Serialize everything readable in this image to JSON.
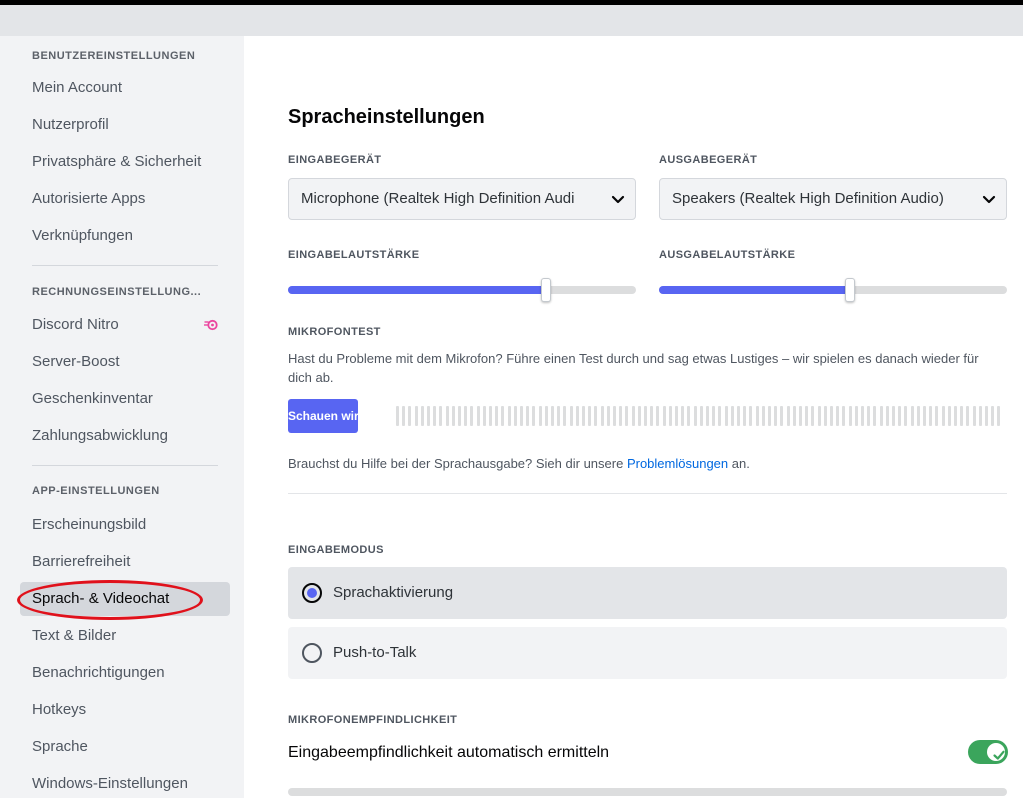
{
  "sidebar": {
    "user_settings_header": "BENUTZEREINSTELLUNGEN",
    "user_items": [
      "Mein Account",
      "Nutzerprofil",
      "Privatsphäre & Sicherheit",
      "Autorisierte Apps",
      "Verknüpfungen"
    ],
    "billing_header": "RECHNUNGSEINSTELLUNG...",
    "billing_items": [
      "Discord Nitro",
      "Server-Boost",
      "Geschenkinventar",
      "Zahlungsabwicklung"
    ],
    "app_header": "APP-EINSTELLUNGEN",
    "app_items": [
      "Erscheinungsbild",
      "Barrierefreiheit",
      "Sprach- & Videochat",
      "Text & Bilder",
      "Benachrichtigungen",
      "Hotkeys",
      "Sprache",
      "Windows-Einstellungen"
    ],
    "selected_item": "Sprach- & Videochat"
  },
  "main": {
    "title": "Spracheinstellungen",
    "input_device_label": "EINGABEGERÄT",
    "input_device_value": "Microphone (Realtek High Definition Audi",
    "output_device_label": "AUSGABEGERÄT",
    "output_device_value": "Speakers (Realtek High Definition Audio)",
    "input_volume_label": "EINGABELAUTSTÄRKE",
    "input_volume_level": 0.74,
    "output_volume_label": "AUSGABELAUTSTÄRKE",
    "output_volume_level": 0.55,
    "mic_test_label": "MIKROFONTEST",
    "mic_test_description": "Hast du Probleme mit dem Mikrofon? Führe einen Test durch und sag etwas Lustiges – wir spielen es danach wieder für dich ab.",
    "mic_test_button": "Schauen wir...",
    "help_text": "Brauchst du Hilfe bei der Sprachausgabe? Sieh dir unsere",
    "help_link": "Problemlösungen",
    "help_suffix": "an.",
    "input_mode_label": "EINGABEMODUS",
    "input_modes": [
      "Sprachaktivierung",
      "Push-to-Talk"
    ],
    "input_mode_selected": "Sprachaktivierung",
    "sensitivity_label": "MIKROFONEMPFINDLICHKEIT",
    "auto_sensitivity_label": "Eingabeempfindlichkeit automatisch ermitteln",
    "auto_sensitivity_enabled": true
  },
  "colors": {
    "accent": "#5865f2",
    "toggle_on": "#3ba55c",
    "link": "#0068e0",
    "annotation": "#e0111b"
  },
  "icons": {
    "nitro": "nitro-icon",
    "select_arrow": "chevron-down-icon",
    "toggle_check": "check-icon"
  }
}
